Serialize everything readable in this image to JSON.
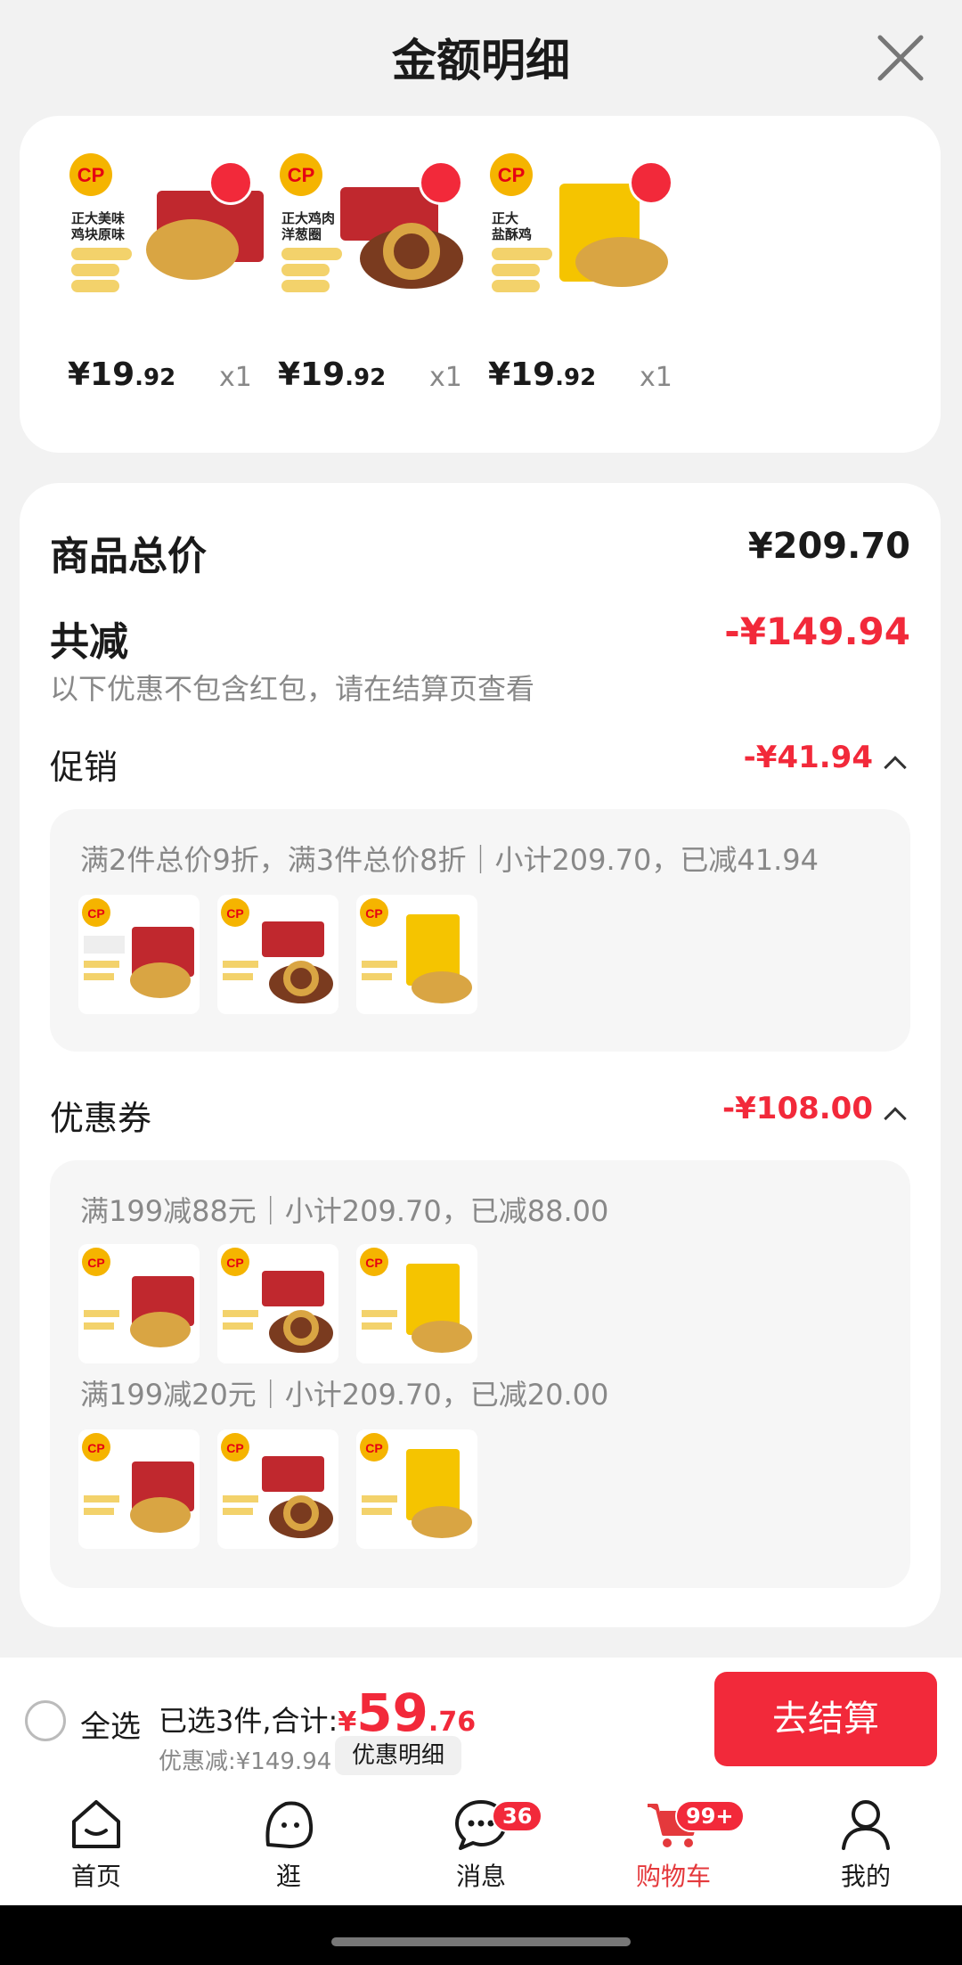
{
  "header": {
    "title": "金额明细",
    "close_icon": "close-icon"
  },
  "products": [
    {
      "brand": "CP",
      "name_lines": [
        "正大美味",
        "鸡块原味"
      ],
      "tags": [
        "京东冷链包邮",
        "鲜嫩多汁",
        "外酥里嫩"
      ],
      "price_int": "¥19",
      "price_dec": ".92",
      "qty": "x1",
      "selected": true
    },
    {
      "brand": "CP",
      "name_lines": [
        "正大鸡肉",
        "洋葱圈"
      ],
      "tags": [
        "京东冷链包邮",
        "风味独特",
        "外酥里嫩"
      ],
      "price_int": "¥19",
      "price_dec": ".92",
      "qty": "x1",
      "selected": true
    },
    {
      "brand": "CP",
      "name_lines": [
        "正大",
        "盐酥鸡"
      ],
      "tags": [
        "京东冷链包邮",
        "鲜嫩鸡肉",
        "外酥里嫩"
      ],
      "price_int": "¥19",
      "price_dec": ".92",
      "qty": "x1",
      "selected": true
    }
  ],
  "summary": {
    "total_label": "商品总价",
    "total_value": "¥209.70",
    "reduce_label": "共减",
    "reduce_value": "-¥149.94",
    "reduce_note": "以下优惠不包含红包，请在结算页查看",
    "promo": {
      "label": "促销",
      "value": "-¥41.94",
      "desc": "满2件总价9折，满3件总价8折｜小计209.70，已减41.94"
    },
    "coupon": {
      "label": "优惠券",
      "value": "-¥108.00",
      "items": [
        {
          "desc": "满199减88元｜小计209.70，已减88.00"
        },
        {
          "desc": "满199减20元｜小计209.70，已减20.00"
        }
      ]
    }
  },
  "bottom_bar": {
    "select_all": "全选",
    "total_prefix": "已选3件,合计:",
    "total_currency": "¥",
    "total_int": "59",
    "total_dec": ".76",
    "discount": "优惠减:¥149.94",
    "detail_button": "优惠明细",
    "checkout_button": "去结算"
  },
  "tabbar": {
    "items": [
      {
        "label": "首页",
        "icon": "home-icon"
      },
      {
        "label": "逛",
        "icon": "browse-icon"
      },
      {
        "label": "消息",
        "icon": "message-icon",
        "badge": "36"
      },
      {
        "label": "购物车",
        "icon": "cart-icon",
        "badge": "99+",
        "active": true
      },
      {
        "label": "我的",
        "icon": "profile-icon"
      }
    ]
  },
  "colors": {
    "accent": "#f2293a",
    "brand_yellow": "#f5b400"
  }
}
